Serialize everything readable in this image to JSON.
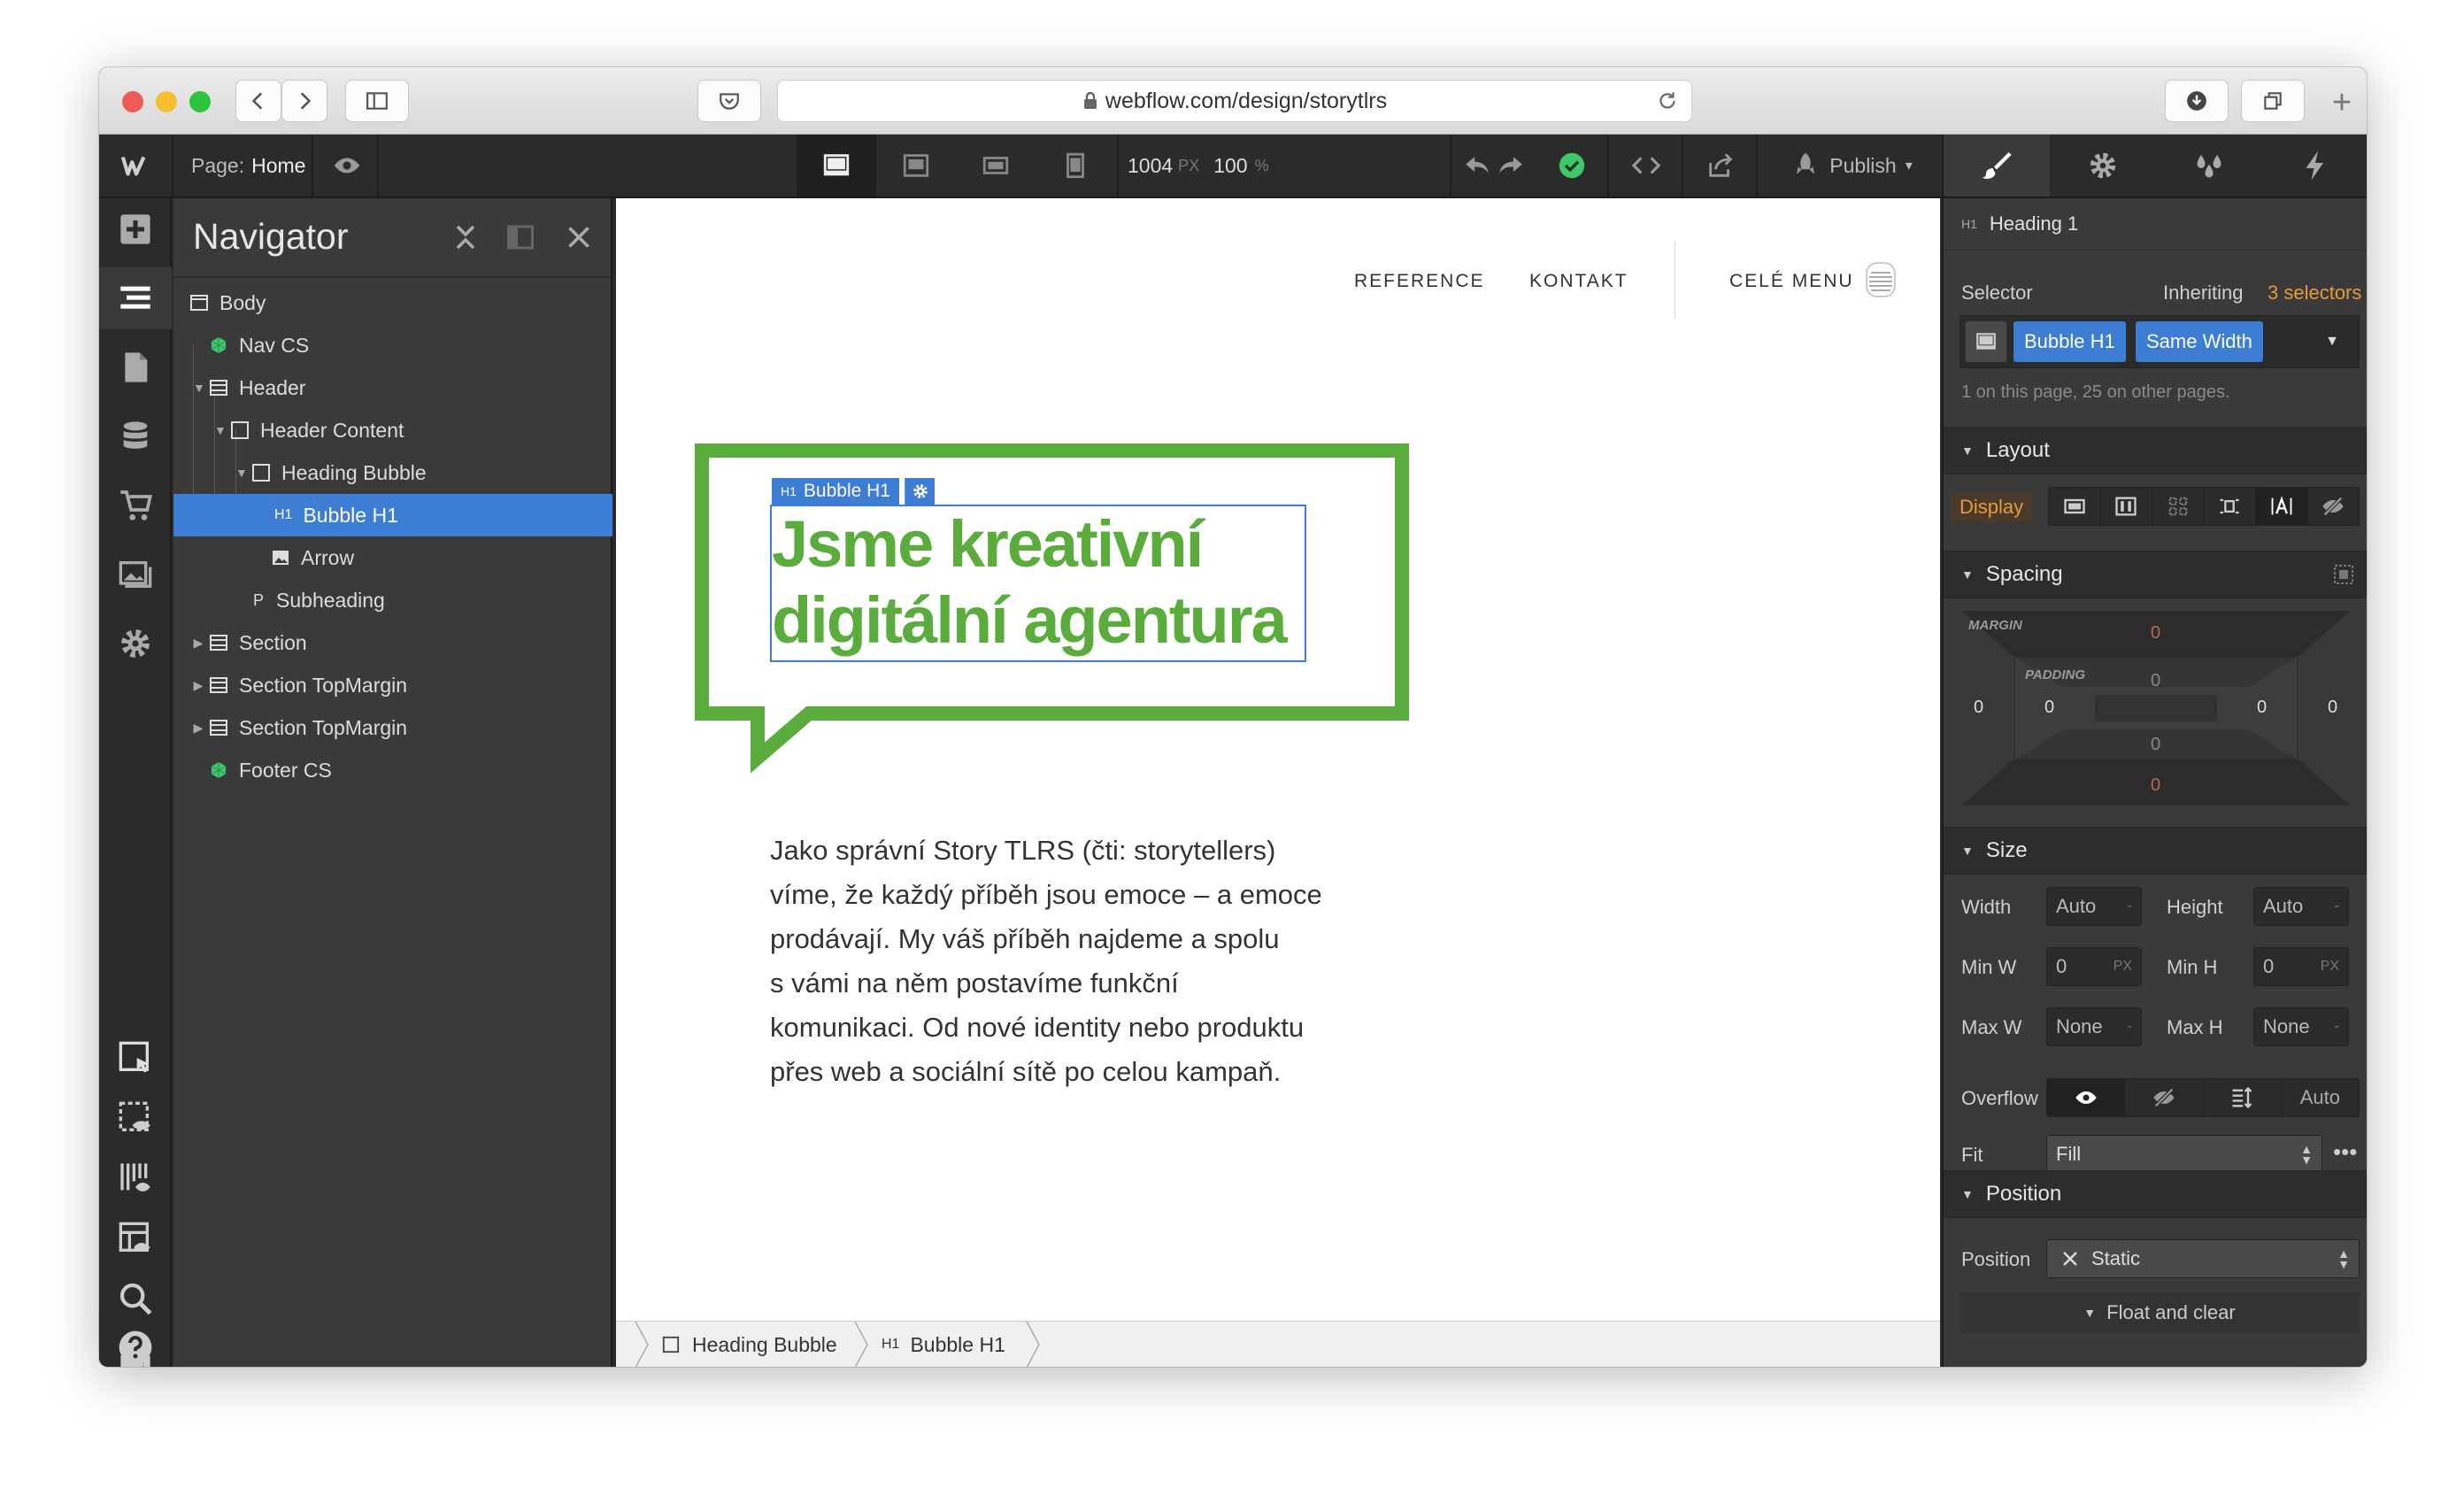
{
  "browser": {
    "url": "webflow.com/design/storytlrs"
  },
  "topbar": {
    "page_label": "Page:",
    "page_name": "Home",
    "canvas_width": "1004",
    "width_unit": "PX",
    "zoom": "100",
    "zoom_unit": "%",
    "publish_label": "Publish"
  },
  "navigator": {
    "title": "Navigator",
    "items": [
      {
        "label": "Body"
      },
      {
        "label": "Nav CS"
      },
      {
        "label": "Header"
      },
      {
        "label": "Header Content"
      },
      {
        "label": "Heading Bubble"
      },
      {
        "label": "Bubble H1",
        "tag": "H1"
      },
      {
        "label": "Arrow"
      },
      {
        "label": "Subheading",
        "tag": "P"
      },
      {
        "label": "Section"
      },
      {
        "label": "Section TopMargin"
      },
      {
        "label": "Section TopMargin"
      },
      {
        "label": "Footer CS"
      }
    ]
  },
  "site": {
    "nav": [
      "REFERENCE",
      "KONTAKT"
    ],
    "menu_label": "CELÉ MENU",
    "selected_tag": "H1",
    "selected_label": "Bubble H1",
    "heading_line1": "Jsme kreativní",
    "heading_line2": "digitální agentura",
    "paragraph": [
      "Jako správní Story TLRS (čti: storytellers)",
      "víme, že každý příběh jsou emoce – a emoce",
      "prodávají. My váš příběh najdeme a spolu",
      "s vámi na něm postavíme funkční",
      "komunikaci. Od nové identity nebo produktu",
      "přes web a sociální sítě po celou kampaň."
    ],
    "accent_color": "#5aad3c"
  },
  "breadcrumbs": [
    {
      "label": "Heading Bubble"
    },
    {
      "tag": "H1",
      "label": "Bubble H1"
    }
  ],
  "style_panel": {
    "element_tag": "H1",
    "element_name": "Heading 1",
    "selector_label": "Selector",
    "inheriting_text": "Inheriting",
    "inheriting_link": "3 selectors",
    "selectors": [
      "Bubble H1",
      "Same Width"
    ],
    "selector_note": "1 on this page, 25 on other pages.",
    "layout_title": "Layout",
    "display_label": "Display",
    "spacing_title": "Spacing",
    "margin_label": "MARGIN",
    "padding_label": "PADDING",
    "margin": {
      "top": "0",
      "right": "0",
      "bottom": "0",
      "left": "0"
    },
    "padding": {
      "top": "0",
      "right": "0",
      "bottom": "0",
      "left": "0"
    },
    "size_title": "Size",
    "width_label": "Width",
    "width_value": "Auto",
    "height_label": "Height",
    "height_value": "Auto",
    "minw_label": "Min W",
    "minw_value": "0",
    "minw_unit": "PX",
    "minh_label": "Min H",
    "minh_value": "0",
    "minh_unit": "PX",
    "maxw_label": "Max W",
    "maxw_value": "None",
    "maxh_label": "Max H",
    "maxh_value": "None",
    "dash": "-",
    "overflow_label": "Overflow",
    "overflow_auto": "Auto",
    "fit_label": "Fit",
    "fit_value": "Fill",
    "position_title": "Position",
    "position_label": "Position",
    "position_value": "Static",
    "float_label": "Float and clear"
  }
}
